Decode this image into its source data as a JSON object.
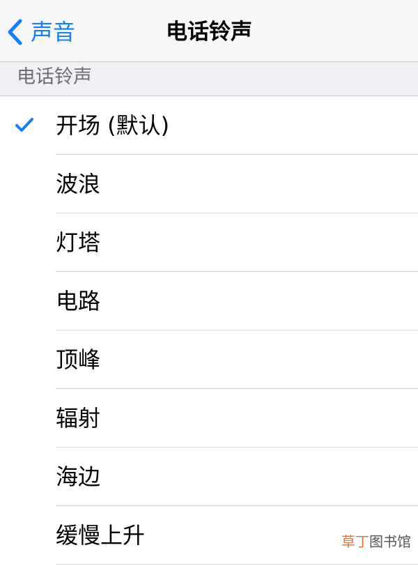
{
  "navbar": {
    "back_label": "声音",
    "title": "电话铃声"
  },
  "section": {
    "header": "电话铃声"
  },
  "ringtones": [
    {
      "label": "开场 (默认)",
      "selected": true
    },
    {
      "label": "波浪",
      "selected": false
    },
    {
      "label": "灯塔",
      "selected": false
    },
    {
      "label": "电路",
      "selected": false
    },
    {
      "label": "顶峰",
      "selected": false
    },
    {
      "label": "辐射",
      "selected": false
    },
    {
      "label": "海边",
      "selected": false
    },
    {
      "label": "缓慢上升",
      "selected": false
    }
  ],
  "watermark": {
    "part1": "草丁",
    "part2": "图书馆"
  },
  "colors": {
    "accent": "#157efb",
    "navbar_bg": "#f7f7f7",
    "section_bg": "#efeff4",
    "section_text": "#6d6d72",
    "separator": "#d8d8dc"
  },
  "icons": {
    "back": "chevron-left-icon",
    "selected": "checkmark-icon"
  }
}
